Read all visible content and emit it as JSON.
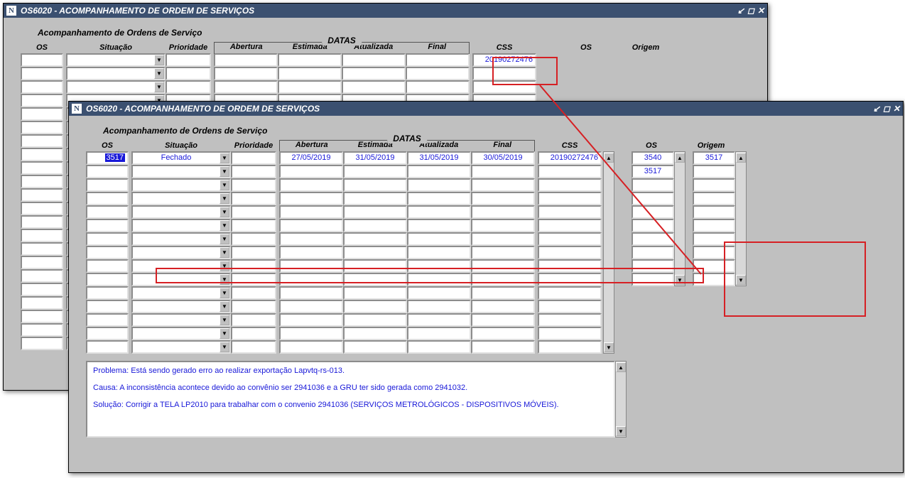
{
  "window": {
    "title": "OS6020 - ACOMPANHAMENTO DE ORDEM DE SERVIÇOS",
    "icon_text": "N"
  },
  "section_title": "Acompanhamento de Ordens de Serviço",
  "datas_label": "DATAS",
  "headers": {
    "os": "OS",
    "situacao": "Situação",
    "prioridade": "Prioridade",
    "abertura": "Abertura",
    "estimada": "Estimada",
    "atualizada": "Atualizada",
    "final": "Final",
    "css": "CSS",
    "os2": "OS",
    "origem": "Origem"
  },
  "back": {
    "css_value": "20190272476"
  },
  "front": {
    "row0": {
      "os": "3517",
      "situacao": "Fechado",
      "prioridade": "",
      "abertura": "27/05/2019",
      "estimada": "31/05/2019",
      "atualizada": "31/05/2019",
      "final": "30/05/2019",
      "css": "20190272476"
    },
    "side_os": [
      "3540",
      "3517"
    ],
    "side_origem": [
      "3517",
      ""
    ]
  },
  "description": {
    "problema": "Problema: Está sendo gerado erro ao realizar exportação Lapvtq-rs-013.",
    "causa": "Causa: A inconsistência acontece devido ao convênio ser 2941036 e a GRU ter sido gerada como 2941032.",
    "solucao": "Solução: Corrigir a TELA LP2010 para trabalhar com o convenio 2941036 (SERVIÇOS METROLÓGICOS - DISPOSITIVOS MÓVEIS)."
  }
}
